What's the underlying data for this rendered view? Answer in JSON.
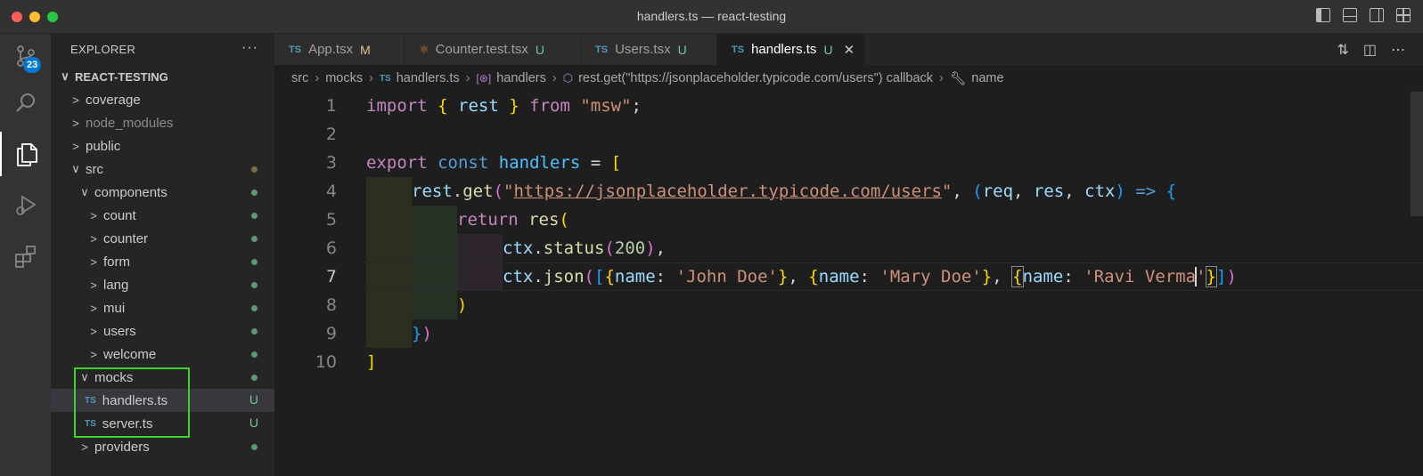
{
  "window": {
    "title": "handlers.ts — react-testing"
  },
  "activity_bar": {
    "scm_badge": "23"
  },
  "sidebar": {
    "header": "EXPLORER",
    "more": "···",
    "project": "REACT-TESTING",
    "tree": [
      {
        "chevron": ">",
        "label": "coverage"
      },
      {
        "chevron": ">",
        "label": "node_modules"
      },
      {
        "chevron": ">",
        "label": "public"
      },
      {
        "chevron": "∨",
        "label": "src"
      },
      {
        "chevron": "∨",
        "label": "components"
      },
      {
        "chevron": ">",
        "label": "count"
      },
      {
        "chevron": ">",
        "label": "counter"
      },
      {
        "chevron": ">",
        "label": "form"
      },
      {
        "chevron": ">",
        "label": "lang"
      },
      {
        "chevron": ">",
        "label": "mui"
      },
      {
        "chevron": ">",
        "label": "users"
      },
      {
        "chevron": ">",
        "label": "welcome"
      },
      {
        "chevron": "∨",
        "label": "mocks"
      },
      {
        "icon": "TS",
        "label": "handlers.ts",
        "status": "U"
      },
      {
        "icon": "TS",
        "label": "server.ts",
        "status": "U"
      },
      {
        "chevron": ">",
        "label": "providers"
      }
    ]
  },
  "tabs": [
    {
      "icon": "TS",
      "label": "App.tsx",
      "flag": "M"
    },
    {
      "icon": "react",
      "label": "Counter.test.tsx",
      "flag": "U"
    },
    {
      "icon": "TS",
      "label": "Users.tsx",
      "flag": "U"
    },
    {
      "icon": "TS",
      "label": "handlers.ts",
      "flag": "U",
      "close": "✕"
    }
  ],
  "breadcrumb": {
    "parts": [
      "src",
      "mocks",
      "handlers.ts",
      "handlers",
      "rest.get(\"https://jsonplaceholder.typicode.com/users\") callback",
      "name"
    ],
    "ts_icon": "TS"
  },
  "editor": {
    "line_numbers": [
      "1",
      "2",
      "3",
      "4",
      "5",
      "6",
      "7",
      "8",
      "9",
      "10"
    ],
    "tokens": {
      "import": "import",
      "lbrace": "{",
      "rest": "rest",
      "rbrace": "}",
      "from": "from",
      "msw": "\"msw\"",
      "semi": ";",
      "export": "export",
      "const": "const",
      "handlers": "handlers",
      "eq": "=",
      "lbrack": "[",
      "rest2": "rest",
      "dot_get": ".",
      "get": "get",
      "lparen": "(",
      "q1": "\"",
      "url": "https://jsonplaceholder.typicode.com/users",
      "q2": "\"",
      "comma1": ", ",
      "lparen2": "(",
      "req": "req",
      "c2": ", ",
      "res": "res",
      "c3": ", ",
      "ctx": "ctx",
      "rparen2": ")",
      "arrow": " => ",
      "lbrace2": "{",
      "return": "return",
      "res2": "res",
      "lparen3": "(",
      "ctx2": "ctx",
      "status": "status",
      "lparen4": "(",
      "n200": "200",
      "rparen4": ")",
      "comma2": ",",
      "ctx3": "ctx",
      "json": "json",
      "lparen5": "(",
      "lbrack2": "[",
      "o1open": "{",
      "name1": "name",
      "colon1": ": ",
      "john": "'John Doe'",
      "o1close": "}",
      "c4": ", ",
      "o2open": "{",
      "name2": "name",
      "colon2": ": ",
      "mary": "'Mary Doe'",
      "o2close": "}",
      "c5": ", ",
      "o3open": "{",
      "name3": "name",
      "colon3": ": ",
      "ravi_a": "'Ravi Verma",
      "ravi_b": "'",
      "o3close": "}",
      "rbrack2": "]",
      "rparen5": ")",
      "rparen3": ")",
      "rbrace2": "}",
      "rparen_end": ")",
      "rbrack_end": "]"
    }
  }
}
